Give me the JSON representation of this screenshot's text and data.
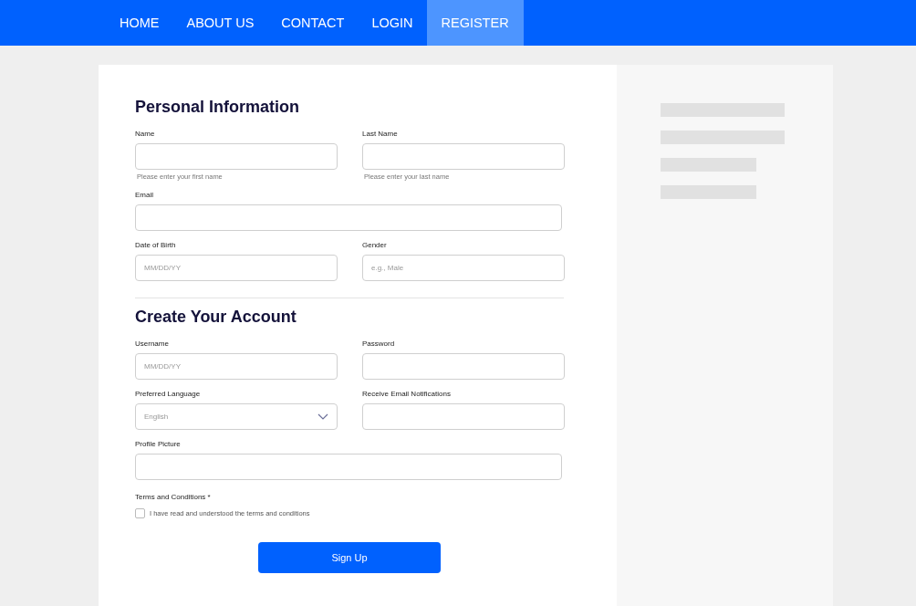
{
  "nav": [
    {
      "label": "HOME",
      "selected": false
    },
    {
      "label": "ABOUT US",
      "selected": false
    },
    {
      "label": "CONTACT",
      "selected": false
    },
    {
      "label": "LOGIN",
      "selected": false
    },
    {
      "label": "REGISTER",
      "selected": true
    }
  ],
  "sections": [
    {
      "title": "Personal Information",
      "fields": [
        {
          "label": "Name",
          "kind": "text",
          "hint": "Please enter your first name"
        },
        {
          "label": "Last Name",
          "kind": "text",
          "hint": "Please enter your last name"
        },
        {
          "label": "Email",
          "kind": "text",
          "full": true
        },
        {
          "label": "Date of Birth",
          "kind": "text",
          "placeholder": "MM/DD/YY"
        },
        {
          "label": "Gender",
          "kind": "text",
          "placeholder": "e.g., Male"
        }
      ]
    },
    {
      "title": "Create Your Account",
      "fields": [
        {
          "label": "Username",
          "kind": "text",
          "placeholder": "MM/DD/YY"
        },
        {
          "label": "Password",
          "kind": "text"
        },
        {
          "label": "Preferred Language",
          "kind": "select",
          "placeholder": "English"
        },
        {
          "label": "Receive Email Notifications",
          "kind": "text"
        },
        {
          "label": "Profile Picture",
          "kind": "text",
          "full": true
        }
      ]
    }
  ],
  "terms": {
    "label": "Terms and Conditions *",
    "checkbox_label": "I have read and understood the terms and conditions",
    "checked": false
  },
  "submit": "Sign Up"
}
